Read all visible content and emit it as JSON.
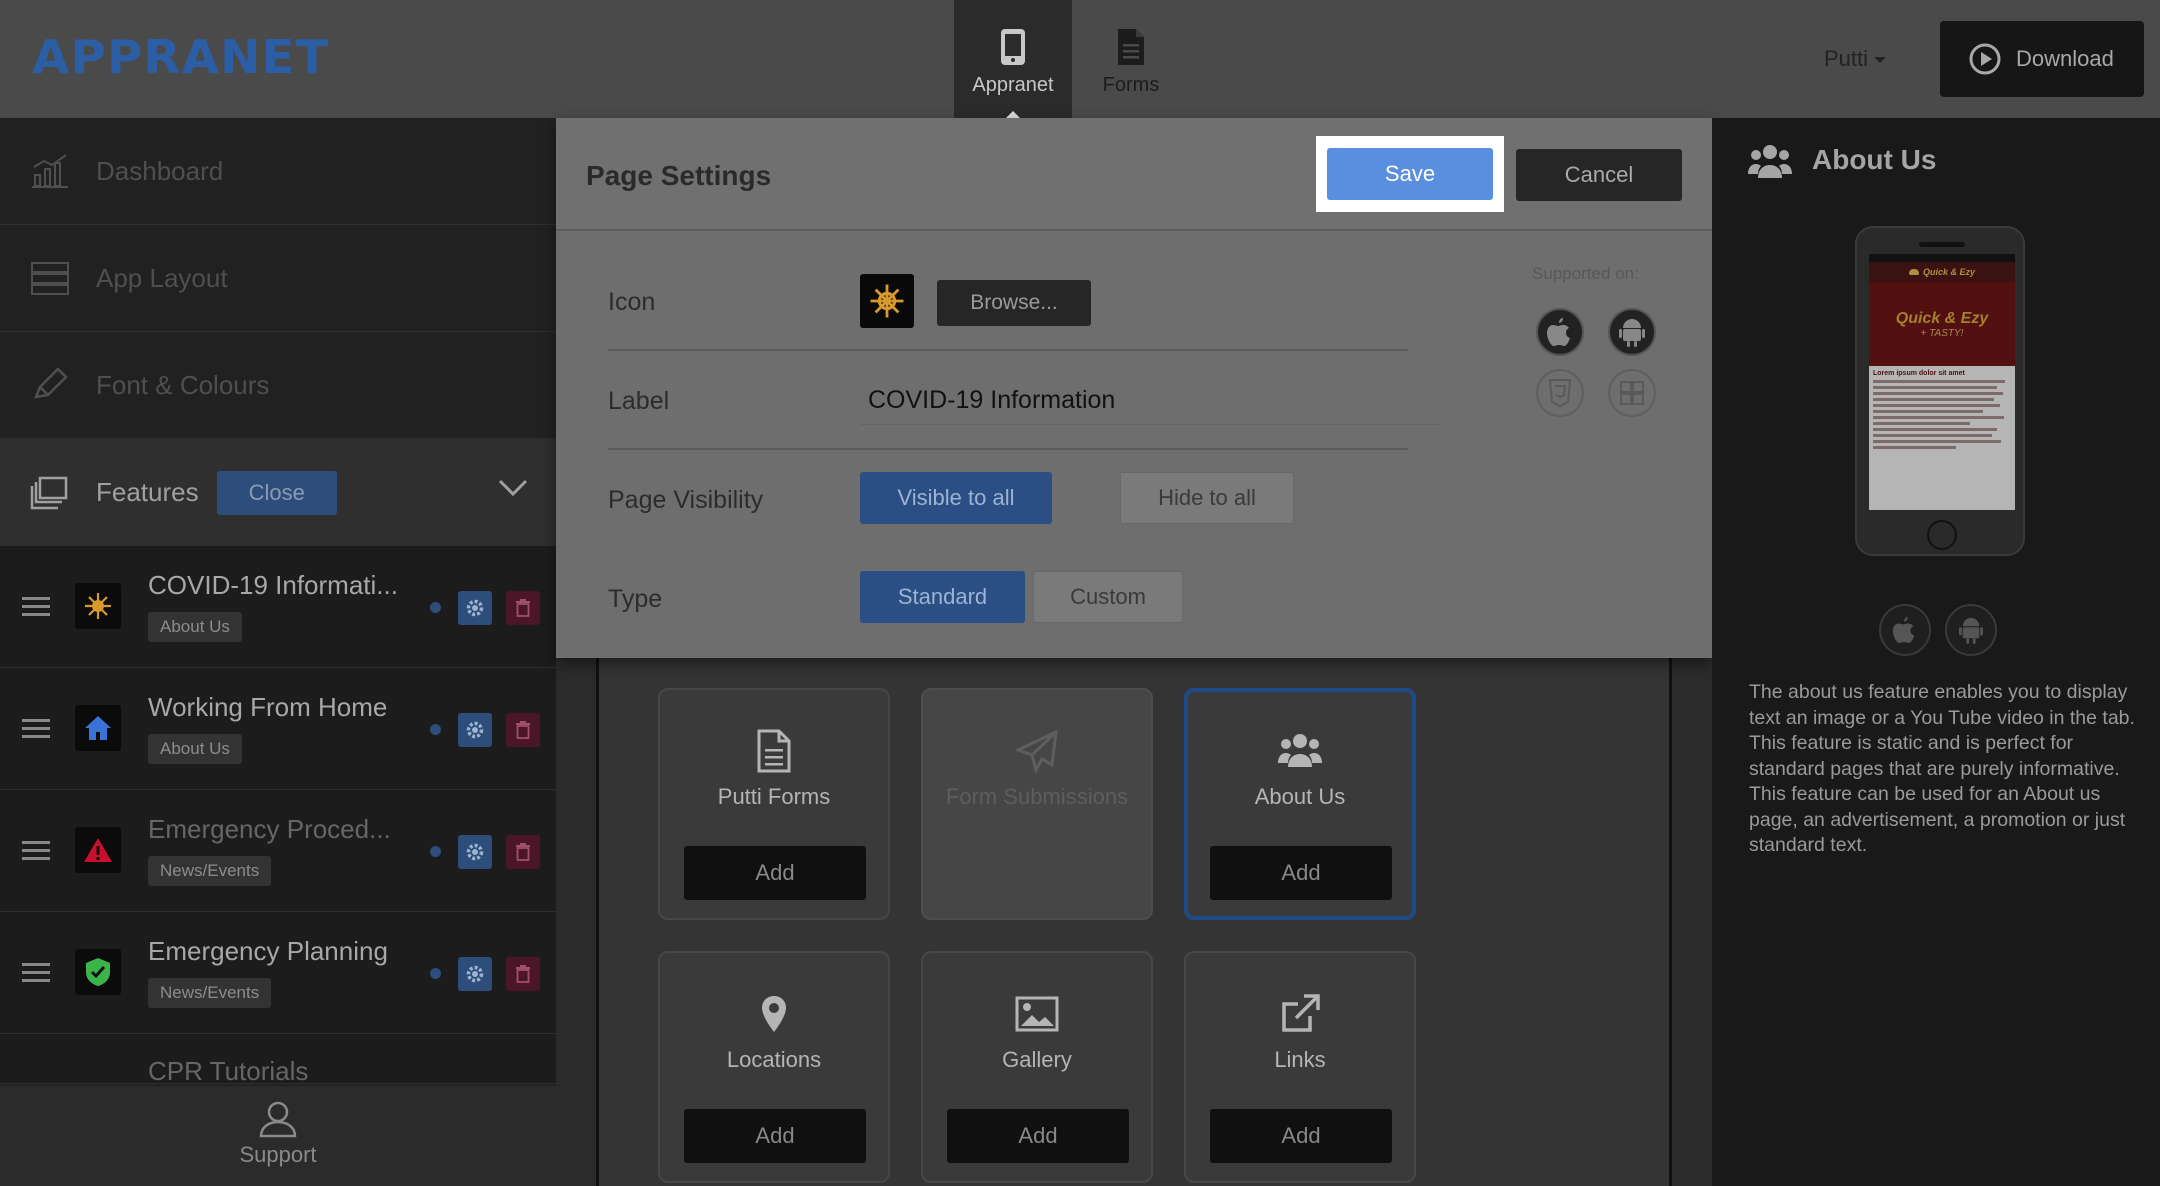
{
  "brand": {
    "logo": "APPRANET"
  },
  "topnav": {
    "tabs": [
      {
        "label": "Appranet",
        "icon": "phone-icon",
        "active": true
      },
      {
        "label": "Forms",
        "icon": "document-icon",
        "active": false
      }
    ],
    "user": "Putti",
    "download_label": "Download"
  },
  "sidebar": {
    "nav": [
      {
        "label": "Dashboard",
        "icon": "bar-chart-icon"
      },
      {
        "label": "App Layout",
        "icon": "layout-icon"
      },
      {
        "label": "Font & Colours",
        "icon": "pencil-icon"
      }
    ],
    "features": {
      "label": "Features",
      "close_label": "Close",
      "icon": "stack-icon"
    },
    "items": [
      {
        "title": "COVID-19 Informati...",
        "tag": "About Us",
        "icon": "virus-icon",
        "icon_color": "#d99a2b",
        "dim": false
      },
      {
        "title": "Working From Home",
        "tag": "About Us",
        "icon": "home-icon",
        "icon_color": "#3a73d6",
        "dim": false
      },
      {
        "title": "Emergency Proced...",
        "tag": "News/Events",
        "icon": "warning-icon",
        "icon_color": "#c8102e",
        "dim": true
      },
      {
        "title": "Emergency Planning",
        "tag": "News/Events",
        "icon": "shield-check-icon",
        "icon_color": "#3bb54a",
        "dim": false
      },
      {
        "title": "CPR Tutorials",
        "tag": "",
        "icon": "",
        "dim": true
      }
    ],
    "support_label": "Support"
  },
  "cards": [
    {
      "name": "Putti Forms",
      "add_label": "Add",
      "icon": "document-icon",
      "state": "normal"
    },
    {
      "name": "Form Submissions",
      "add_label": "",
      "icon": "paper-plane-icon",
      "state": "disabled"
    },
    {
      "name": "About Us",
      "add_label": "Add",
      "icon": "people-icon",
      "state": "selected"
    },
    {
      "name": "Locations",
      "add_label": "Add",
      "icon": "map-pin-icon",
      "state": "normal"
    },
    {
      "name": "Gallery",
      "add_label": "Add",
      "icon": "image-icon",
      "state": "normal"
    },
    {
      "name": "Links",
      "add_label": "Add",
      "icon": "external-link-icon",
      "state": "normal"
    }
  ],
  "modal": {
    "title": "Page Settings",
    "save_label": "Save",
    "cancel_label": "Cancel",
    "supported_label": "Supported on:",
    "icon_field": {
      "label": "Icon",
      "browse_label": "Browse..."
    },
    "label_field": {
      "label": "Label",
      "value": "COVID-19 Information"
    },
    "visibility": {
      "label": "Page Visibility",
      "options": [
        "Visible to all",
        "Hide to all"
      ],
      "selected": "Visible to all"
    },
    "type": {
      "label": "Type",
      "options": [
        "Standard",
        "Custom"
      ],
      "selected": "Standard"
    },
    "platforms": [
      {
        "name": "apple-icon",
        "supported": true
      },
      {
        "name": "android-icon",
        "supported": true
      },
      {
        "name": "html5-icon",
        "supported": false
      },
      {
        "name": "windows-icon",
        "supported": false
      }
    ]
  },
  "preview": {
    "title": "About Us",
    "app_name": "Quick & Ezy",
    "app_tagline": "+ TASTY!",
    "screen_heading": "Lorem ipsum dolor sit amet",
    "description": "The about us feature enables you to display text an image or a You Tube video in the tab. This feature is static and is perfect for standard pages that are purely informative. This feature can be used for an About us page, an advertisement, a promotion or just standard text."
  },
  "colors": {
    "accent_blue": "#5a8fe0",
    "logo_blue": "#2c5ea6",
    "delete_red": "#4a1628"
  }
}
